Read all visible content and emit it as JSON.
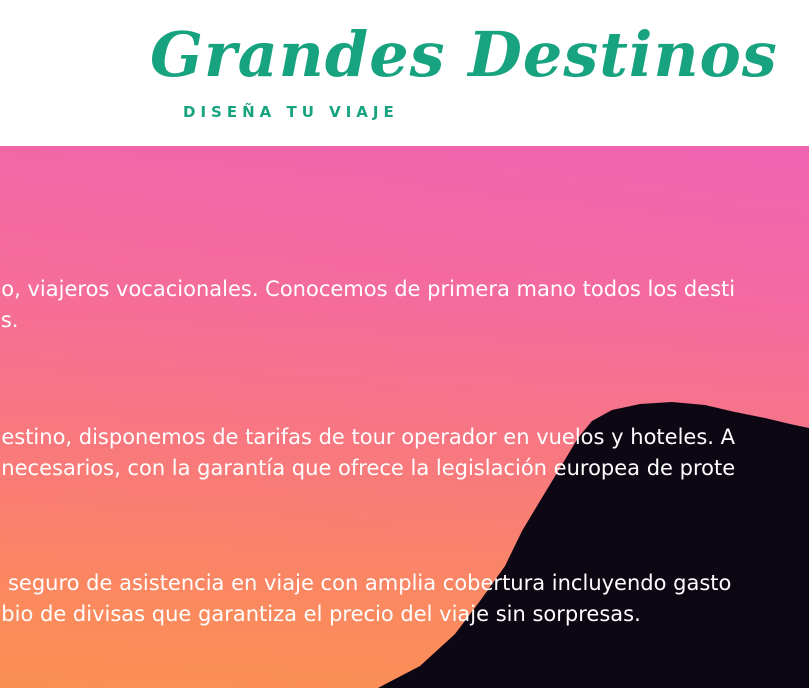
{
  "header": {
    "title": "Grandes Destinos",
    "tagline": "DISEÑA TU VIAJE"
  },
  "hero": {
    "paragraphs": [
      {
        "line1": "no, viajeros vocacionales. Conocemos de primera mano todos los desti",
        "line2": "os."
      },
      {
        "line1": "destino, disponemos de tarifas de tour operador en vuelos y hoteles. A",
        "line2": "nnecesarios, con la garantía que ofrece la legislación europea de prote"
      },
      {
        "line1": "n seguro de asistencia en viaje con amplia cobertura incluyendo gasto",
        "line2": "nbio de divisas que garantiza el precio del viaje sin sorpresas."
      }
    ]
  },
  "colors": {
    "brand": "#17a37f",
    "hero_top": "#ef64b4",
    "hero_bottom": "#fc9452",
    "silhouette": "#0d0714"
  }
}
